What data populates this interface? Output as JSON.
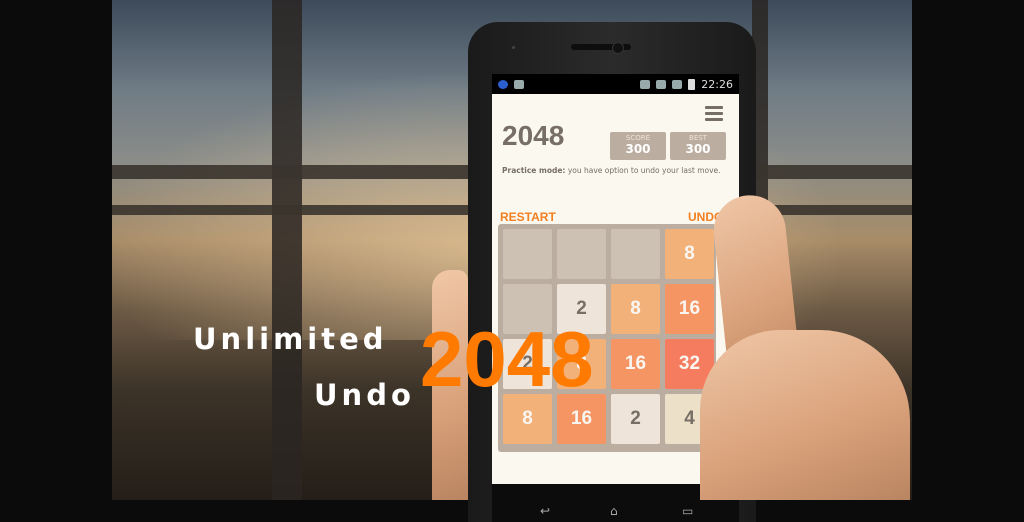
{
  "promo": {
    "line1": "Unlimited",
    "line2": "Undo",
    "number": "2048",
    "accent_color": "#ff7a00"
  },
  "status_bar": {
    "time": "22:26",
    "left_icons": [
      "app-notification-icon",
      "image-notification-icon"
    ],
    "right_icons": [
      "rotate-icon",
      "wifi-icon",
      "signal-icon",
      "battery-icon"
    ]
  },
  "game": {
    "title": "2048",
    "score_label": "SCORE",
    "score": "300",
    "best_label": "BEST",
    "best": "300",
    "practice_label": "Practice mode:",
    "practice_text": "you have option to undo your last move.",
    "restart_label": "RESTART",
    "undo_label": "UNDO",
    "menu_icon": "hamburger-menu-icon",
    "board": [
      [
        "",
        "",
        "",
        "8"
      ],
      [
        "",
        "2",
        "8",
        "16"
      ],
      [
        "2",
        "8",
        "16",
        "32"
      ],
      [
        "8",
        "16",
        "2",
        "4"
      ]
    ]
  },
  "navbar": {
    "icons": [
      "back-icon",
      "home-icon",
      "recents-icon"
    ]
  }
}
